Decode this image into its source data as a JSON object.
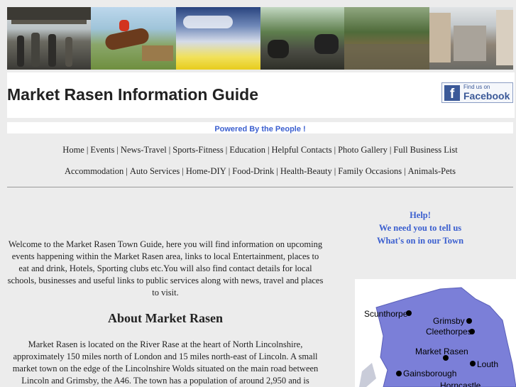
{
  "banner": {
    "photos": [
      "market-crowd-photo",
      "horse-racing-photo",
      "rapeseed-field-photo",
      "motorcycle-race-photo",
      "river-photo",
      "high-street-photo"
    ]
  },
  "header": {
    "title": "Market Rasen Information Guide",
    "facebook": {
      "find_us": "Find us on",
      "brand": "Facebook",
      "icon_letter": "f"
    }
  },
  "powered_by": "Powered By the People !",
  "nav": {
    "row1": [
      "Home",
      "Events",
      "News-Travel",
      "Sports-Fitness",
      "Education",
      "Helpful Contacts",
      "Photo Gallery",
      "Full Business List"
    ],
    "row2": [
      "Accommodation",
      "Auto Services",
      "Home-DIY",
      "Food-Drink",
      "Health-Beauty",
      "Family Occasions",
      "Animals-Pets"
    ]
  },
  "intro_text": "Welcome to the Market Rasen Town Guide, here you will find information on upcoming events happening within the Market Rasen area, links to local Entertainment, places to eat and drink, Hotels, Sporting clubs etc.You will also find contact details for local schools, businesses and useful links to public services along with news, travel and places to visit.",
  "about": {
    "heading": "About Market Rasen",
    "text": "Market Rasen is located on the River Rase at the heart of North Lincolnshire, approximately 150 miles north of London and 15 miles north-east of Lincoln. A small market town on the edge of the Lincolnshire Wolds situated on the main road between Lincoln and Grimsby, the A46. The town has a population of around 2,950 and is"
  },
  "help": {
    "line1": "Help!",
    "line2": "We need you to tell us",
    "line3": "What's on in our Town"
  },
  "map": {
    "places": [
      "Scunthorpe",
      "Grimsby",
      "Cleethorpes",
      "Market Rasen",
      "Louth",
      "Gainsborough",
      "Horncastle"
    ]
  },
  "colors": {
    "background": "#ececec",
    "accent_link": "#3b5fcf",
    "facebook_blue": "#3b5998",
    "map_land": "#7b7fd8"
  }
}
